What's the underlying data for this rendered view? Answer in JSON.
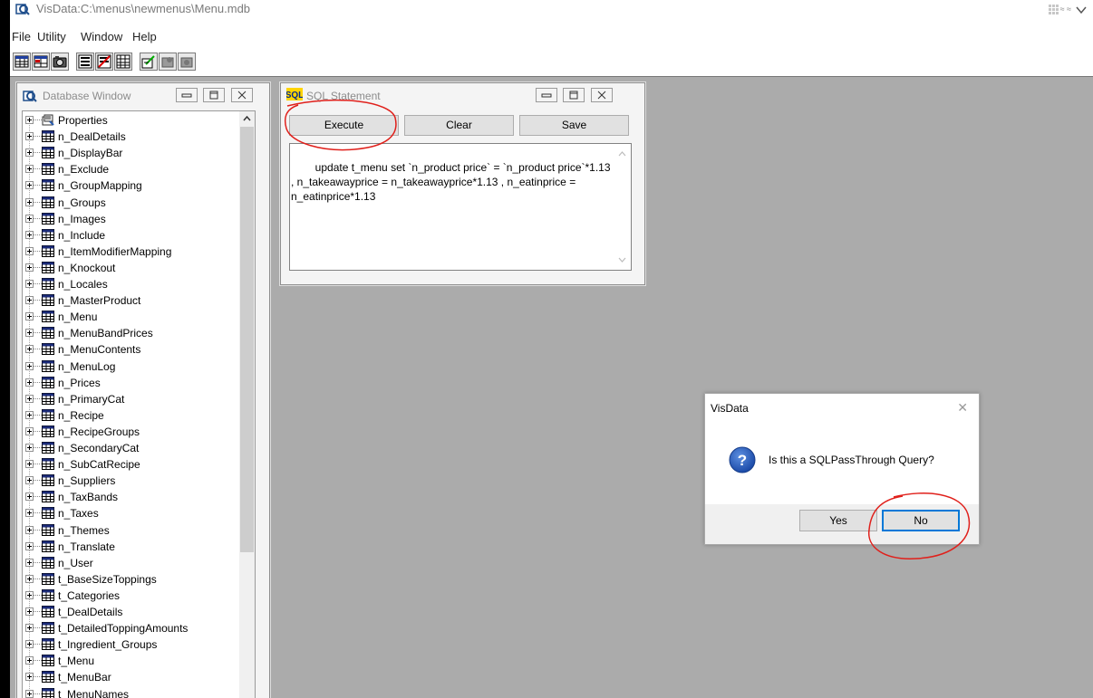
{
  "app": {
    "title": "VisData:C:\\menus\\newmenus\\Menu.mdb"
  },
  "title_controls": {
    "restore_text": "≈ ≈"
  },
  "menubar": {
    "items": [
      "File",
      "Utility",
      "Window",
      "Help"
    ]
  },
  "toolbar": {
    "buttons": [
      "table-icon",
      "dynaset-icon",
      "snapshot-icon",
      "form-icon",
      "form-icon",
      "grid-icon",
      "edit-icon",
      "data-icon",
      "data-icon"
    ]
  },
  "database_window": {
    "title": "Database Window",
    "items": [
      "Properties",
      "n_DealDetails",
      "n_DisplayBar",
      "n_Exclude",
      "n_GroupMapping",
      "n_Groups",
      "n_Images",
      "n_Include",
      "n_ItemModifierMapping",
      "n_Knockout",
      "n_Locales",
      "n_MasterProduct",
      "n_Menu",
      "n_MenuBandPrices",
      "n_MenuContents",
      "n_MenuLog",
      "n_Prices",
      "n_PrimaryCat",
      "n_Recipe",
      "n_RecipeGroups",
      "n_SecondaryCat",
      "n_SubCatRecipe",
      "n_Suppliers",
      "n_TaxBands",
      "n_Taxes",
      "n_Themes",
      "n_Translate",
      "n_User",
      "t_BaseSizeToppings",
      "t_Categories",
      "t_DealDetails",
      "t_DetailedToppingAmounts",
      "t_Ingredient_Groups",
      "t_Menu",
      "t_MenuBar",
      "t_MenuNames"
    ]
  },
  "sql_window": {
    "title": "SQL Statement",
    "execute_label": "Execute",
    "clear_label": "Clear",
    "save_label": "Save",
    "statement": "update t_menu set `n_product price` = `n_product price`*1.13 , n_takeawayprice = n_takeawayprice*1.13 , n_eatinprice = n_eatinprice*1.13"
  },
  "dialog": {
    "title": "VisData",
    "message": "Is this a SQLPassThrough Query?",
    "yes_label": "Yes",
    "no_label": "No"
  },
  "colors": {
    "mdi_background": "#ababab",
    "annotation": "#e0201b",
    "dialog_focus": "#0078d7"
  }
}
